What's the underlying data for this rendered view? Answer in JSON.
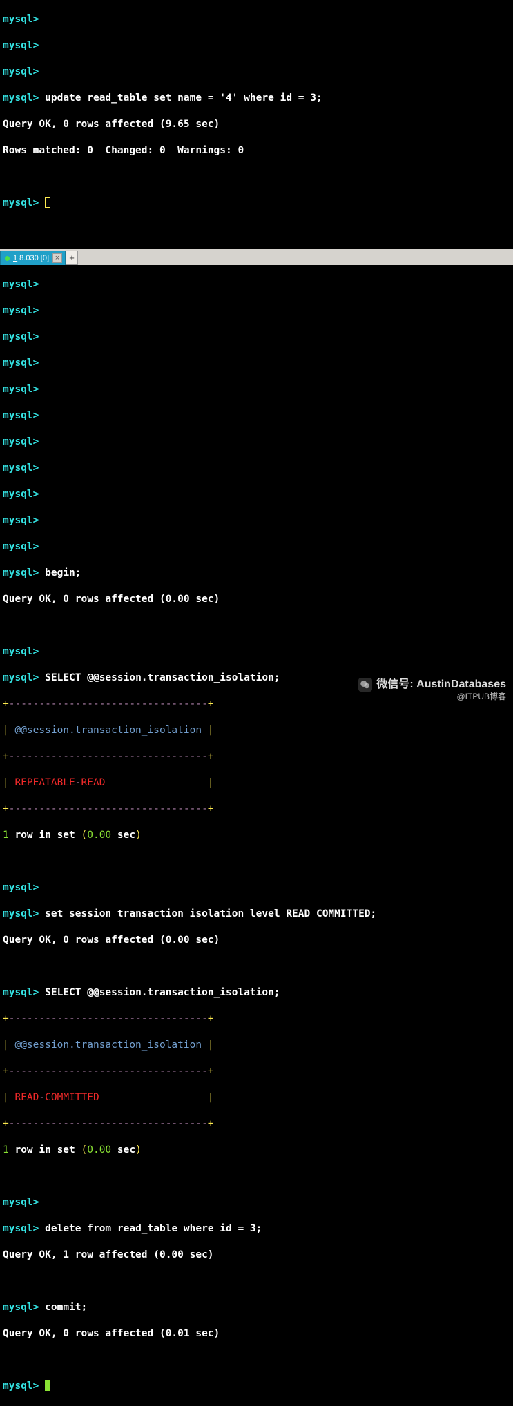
{
  "top_terminal": {
    "prompt": "mysql>",
    "empty_count": 3,
    "update_cmd": "update read_table set name = '4' where id = 3;",
    "update_result1": "Query OK, 0 rows affected (9.65 sec)",
    "update_result2": "Rows matched: 0  Changed: 0  Warnings: 0"
  },
  "tab": {
    "underline": "1",
    "rest": " 8.030 [0]",
    "close": "×",
    "add": "+"
  },
  "bottom_terminal": {
    "prompt": "mysql>",
    "empty_count": 11,
    "begin_cmd": "begin;",
    "begin_result": "Query OK, 0 rows affected (0.00 sec)",
    "sel1_cmd": "SELECT @@session.transaction_isolation;",
    "border": "+---------------------------------+",
    "header": "| @@session.transaction_isolation |",
    "row1": "| REPEATABLE-READ                 |",
    "count1": "1 row in set (0.00 sec)",
    "setiso_cmd": "set session transaction isolation level READ COMMITTED;",
    "setiso_result": "Query OK, 0 rows affected (0.00 sec)",
    "sel2_cmd": "SELECT @@session.transaction_isolation;",
    "row2": "| READ-COMMITTED                  |",
    "count2": "1 row in set (0.00 sec)",
    "del_cmd": "delete from read_table where id = 3;",
    "del_result": "Query OK, 1 row affected (0.00 sec)",
    "commit_cmd": "commit;",
    "commit_result": "Query OK, 0 rows affected (0.01 sec)"
  },
  "watermark": {
    "label": "微信号: AustinDatabases",
    "sub": "@ITPUB博客"
  }
}
